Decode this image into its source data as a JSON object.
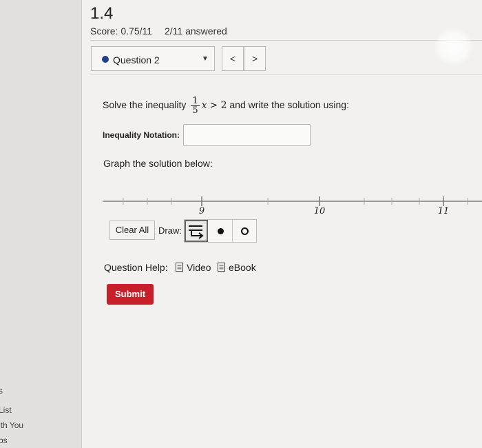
{
  "sidebar": {
    "items": [
      "s",
      "List",
      "ith You",
      "bs"
    ]
  },
  "header": {
    "title": "1.4",
    "score": "Score: 0.75/11",
    "answered": "2/11 answered"
  },
  "question_nav": {
    "selected": "Question 2",
    "prev_label": "<",
    "next_label": ">"
  },
  "problem": {
    "prefix": "Solve the inequality",
    "numerator": "1",
    "denominator": "5",
    "variable": "x",
    "relation": "> 2",
    "suffix": "and write the solution using:"
  },
  "inequality": {
    "label": "Inequality Notation:",
    "value": ""
  },
  "graph": {
    "prompt": "Graph the solution below:",
    "tick_labels": [
      "9",
      "10",
      "11"
    ]
  },
  "tools": {
    "clear_label": "Clear All",
    "draw_label": "Draw:"
  },
  "help": {
    "label": "Question Help:",
    "video": "Video",
    "ebook": "eBook"
  },
  "submit_label": "Submit",
  "colors": {
    "accent_blue": "#233e8b",
    "submit_red": "#c8202a"
  }
}
